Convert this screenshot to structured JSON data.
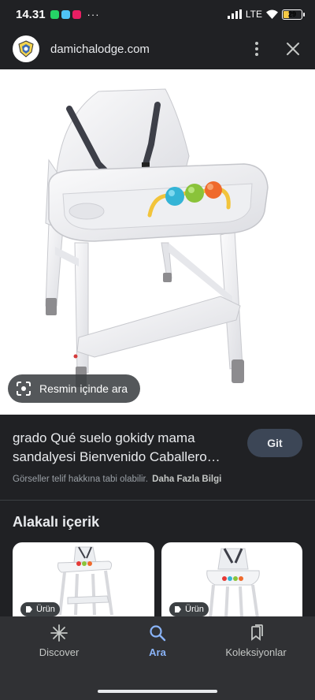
{
  "status_bar": {
    "time": "14.31",
    "more": "···",
    "network": "LTE",
    "battery": "29"
  },
  "header": {
    "domain": "damichalodge.com",
    "icons": [
      "site-logo",
      "more-vert-icon",
      "close-icon"
    ]
  },
  "image": {
    "lens_label": "Resmin içinde ara"
  },
  "result": {
    "title": "grado Qué suelo gokidy mama sandalyesi Bienvenido Caballero…",
    "visit_label": "Git",
    "copyright_text": "Görseller telif hakkına tabi olabilir.",
    "more_info_label": "Daha Fazla Bilgi"
  },
  "related": {
    "title": "Alakalı içerik",
    "cards": [
      {
        "badge": "Ürün"
      },
      {
        "badge": "Ürün"
      }
    ]
  },
  "bottom_nav": {
    "items": [
      {
        "label": "Discover",
        "icon": "asterisk-icon"
      },
      {
        "label": "Ara",
        "icon": "search-icon",
        "active": true
      },
      {
        "label": "Koleksiyonlar",
        "icon": "bookmarks-icon"
      }
    ]
  },
  "colors": {
    "background": "#202124",
    "accent": "#8ab4f8",
    "button": "#3c4656"
  }
}
